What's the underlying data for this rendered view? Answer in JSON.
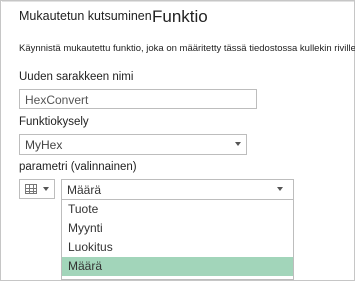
{
  "dialog": {
    "title": "Mukautetun kutsuminen",
    "subtitle": "Funktio",
    "description": "Käynnistä mukautettu funktio, joka on määritetty tässä tiedostossa kullekin riville."
  },
  "new_column": {
    "label": "Uuden sarakkeen nimi",
    "value": "HexConvert"
  },
  "function_query": {
    "label": "Funktiokysely",
    "selected": "MyHex"
  },
  "parameter": {
    "label": "parametri (valinnainen)",
    "type_icon": "table-icon",
    "selected": "Määrä",
    "options": [
      {
        "label": "Tuote",
        "selected": false
      },
      {
        "label": "Myynti",
        "selected": false
      },
      {
        "label": "Luokitus",
        "selected": false
      },
      {
        "label": "Määrä",
        "selected": true
      }
    ]
  },
  "colors": {
    "selected_option_bg": "#a2d5ba",
    "border": "#bdbdbd"
  }
}
